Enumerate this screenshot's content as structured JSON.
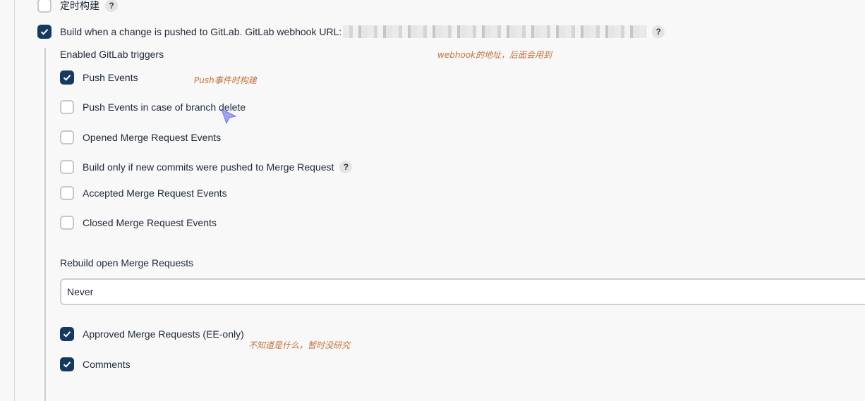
{
  "timed_build": {
    "label": "定时构建",
    "checked": false,
    "help": "?"
  },
  "gitlab_trigger": {
    "label": "Build when a change is pushed to GitLab. GitLab webhook URL:",
    "checked": true,
    "help": "?"
  },
  "annotations": {
    "webhook_note": "webhook的地址，后面会用到",
    "push_note": "Push事件时构建",
    "approved_note": "不知道是什么，暂时没研究"
  },
  "triggers": {
    "heading": "Enabled GitLab triggers",
    "items": [
      {
        "label": "Push Events",
        "checked": true
      },
      {
        "label": "Push Events in case of branch delete",
        "checked": false
      },
      {
        "label": "Opened Merge Request Events",
        "checked": false
      },
      {
        "label": "Build only if new commits were pushed to Merge Request",
        "checked": false,
        "help": "?"
      },
      {
        "label": "Accepted Merge Request Events",
        "checked": false
      },
      {
        "label": "Closed Merge Request Events",
        "checked": false
      }
    ]
  },
  "rebuild": {
    "label": "Rebuild open Merge Requests",
    "value": "Never"
  },
  "extra": {
    "items": [
      {
        "label": "Approved Merge Requests (EE-only)",
        "checked": true
      },
      {
        "label": "Comments",
        "checked": true
      }
    ]
  },
  "colors": {
    "checkbox_checked": "#163a5f",
    "note_text": "#c0703a"
  }
}
